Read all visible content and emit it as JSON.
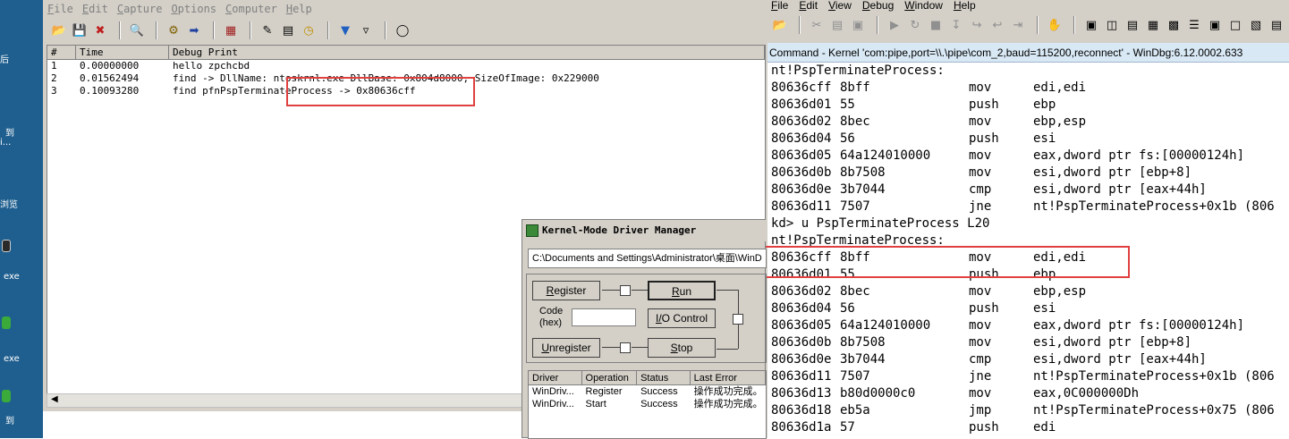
{
  "desktop": {
    "labels": [
      "后",
      "到",
      "i...",
      "浏览",
      "exe",
      "exe",
      "到"
    ]
  },
  "debugview": {
    "menu": [
      "File",
      "Edit",
      "Capture",
      "Options",
      "Computer",
      "Help"
    ],
    "columns": [
      "#",
      "Time",
      "Debug Print"
    ],
    "rows": [
      {
        "num": "1",
        "time": "0.00000000",
        "msg": "hello zpchcbd"
      },
      {
        "num": "2",
        "time": "0.01562494",
        "msg": "find -> DllName: ntoskrnl.exe DllBase: 0x804d8000, SizeOfImage: 0x229000"
      },
      {
        "num": "3",
        "time": "0.10093280",
        "msg": "find pfnPspTerminateProcess -> 0x80636cff"
      }
    ]
  },
  "windbg": {
    "menu": [
      "File",
      "Edit",
      "View",
      "Debug",
      "Window",
      "Help"
    ],
    "title": "Command - Kernel 'com:pipe,port=\\\\.\\pipe\\com_2,baud=115200,reconnect' - WinDbg:6.12.0002.633",
    "lines": [
      {
        "text": "nt!PspTerminateProcess:"
      },
      {
        "addr": "80636cff",
        "bytes": "8bff",
        "mnem": "mov",
        "ops": "edi,edi"
      },
      {
        "addr": "80636d01",
        "bytes": "55",
        "mnem": "push",
        "ops": "ebp"
      },
      {
        "addr": "80636d02",
        "bytes": "8bec",
        "mnem": "mov",
        "ops": "ebp,esp"
      },
      {
        "addr": "80636d04",
        "bytes": "56",
        "mnem": "push",
        "ops": "esi"
      },
      {
        "addr": "80636d05",
        "bytes": "64a124010000",
        "mnem": "mov",
        "ops": "eax,dword ptr fs:[00000124h]"
      },
      {
        "addr": "80636d0b",
        "bytes": "8b7508",
        "mnem": "mov",
        "ops": "esi,dword ptr [ebp+8]"
      },
      {
        "addr": "80636d0e",
        "bytes": "3b7044",
        "mnem": "cmp",
        "ops": "esi,dword ptr [eax+44h]"
      },
      {
        "addr": "80636d11",
        "bytes": "7507",
        "mnem": "jne",
        "ops": "nt!PspTerminateProcess+0x1b (806"
      },
      {
        "text": "kd> u PspTerminateProcess L20"
      },
      {
        "text": "nt!PspTerminateProcess:"
      },
      {
        "addr": "80636cff",
        "bytes": "8bff",
        "mnem": "mov",
        "ops": "edi,edi"
      },
      {
        "addr": "80636d01",
        "bytes": "55",
        "mnem": "push",
        "ops": "ebp"
      },
      {
        "addr": "80636d02",
        "bytes": "8bec",
        "mnem": "mov",
        "ops": "ebp,esp"
      },
      {
        "addr": "80636d04",
        "bytes": "56",
        "mnem": "push",
        "ops": "esi"
      },
      {
        "addr": "80636d05",
        "bytes": "64a124010000",
        "mnem": "mov",
        "ops": "eax,dword ptr fs:[00000124h]"
      },
      {
        "addr": "80636d0b",
        "bytes": "8b7508",
        "mnem": "mov",
        "ops": "esi,dword ptr [ebp+8]"
      },
      {
        "addr": "80636d0e",
        "bytes": "3b7044",
        "mnem": "cmp",
        "ops": "esi,dword ptr [eax+44h]"
      },
      {
        "addr": "80636d11",
        "bytes": "7507",
        "mnem": "jne",
        "ops": "nt!PspTerminateProcess+0x1b (806"
      },
      {
        "addr": "80636d13",
        "bytes": "b80d0000c0",
        "mnem": "mov",
        "ops": "eax,0C000000Dh"
      },
      {
        "addr": "80636d18",
        "bytes": "eb5a",
        "mnem": "jmp",
        "ops": "nt!PspTerminateProcess+0x75 (806"
      },
      {
        "addr": "80636d1a",
        "bytes": "57",
        "mnem": "push",
        "ops": "edi"
      }
    ]
  },
  "driver_manager": {
    "title": "Kernel-Mode Driver Manager",
    "path": "C:\\Documents and Settings\\Administrator\\桌面\\WinD",
    "buttons": {
      "register": "Register",
      "run": "Run",
      "io_control": "I/O Control",
      "unregister": "Unregister",
      "stop": "Stop"
    },
    "code_label_1": "Code",
    "code_label_2": "(hex)",
    "columns": [
      "Driver",
      "Operation",
      "Status",
      "Last Error"
    ],
    "rows": [
      {
        "driver": "WinDriv...",
        "operation": "Register",
        "status": "Success",
        "error": "操作成功完成。"
      },
      {
        "driver": "WinDriv...",
        "operation": "Start",
        "status": "Success",
        "error": "操作成功完成。"
      }
    ]
  },
  "colors": {
    "highlight": "#e04040",
    "desktop": "#1f5f8f",
    "window_face": "#d4d0c8"
  }
}
